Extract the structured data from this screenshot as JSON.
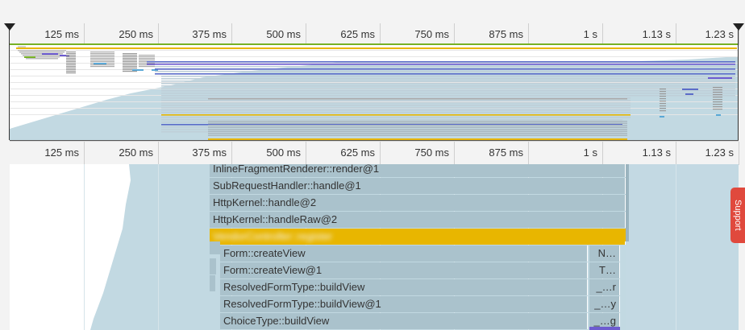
{
  "timeline": {
    "tick_labels": [
      "125 ms",
      "250 ms",
      "375 ms",
      "500 ms",
      "625 ms",
      "750 ms",
      "875 ms",
      "1 s",
      "1.13 s",
      "1.23 s"
    ]
  },
  "colors": {
    "area": "#c2d9e2",
    "frame": "#aac2cc",
    "highlight": "#e8b600",
    "purple": "#6d5bd0",
    "blue": "#5b6cc9",
    "green": "#77b126",
    "gray": "#d4d4d4"
  },
  "flame": {
    "frames": [
      {
        "label": "InlineFragmentRenderer::render@1",
        "depth": 0,
        "kind": "normal"
      },
      {
        "label": "SubRequestHandler::handle@1",
        "depth": 1,
        "kind": "normal"
      },
      {
        "label": "HttpKernel::handle@2",
        "depth": 2,
        "kind": "normal"
      },
      {
        "label": "HttpKernel::handleRaw@2",
        "depth": 3,
        "kind": "normal"
      },
      {
        "label": "VendorController::register",
        "depth": 4,
        "kind": "highlight"
      },
      {
        "label": "Form::createView",
        "depth": 5,
        "kind": "normal",
        "side": "N…"
      },
      {
        "label": "Form::createView@1",
        "depth": 6,
        "kind": "normal",
        "side": "T…"
      },
      {
        "label": "ResolvedFormType::buildView",
        "depth": 7,
        "kind": "normal",
        "side": "_…r"
      },
      {
        "label": "ResolvedFormType::buildView@1",
        "depth": 8,
        "kind": "normal",
        "side": "_…y"
      },
      {
        "label": "ChoiceType::buildView",
        "depth": 9,
        "kind": "normal",
        "side": "_…g"
      }
    ]
  },
  "support_label": "Support"
}
